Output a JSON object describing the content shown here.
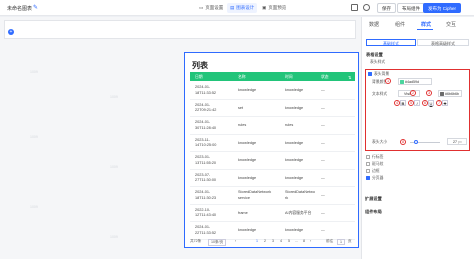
{
  "header": {
    "page_title": "未命名图表",
    "nav": [
      {
        "label": "页面设置",
        "active": false
      },
      {
        "label": "图表设计",
        "active": true
      },
      {
        "label": "页面预览",
        "active": false
      }
    ],
    "buttons": {
      "save": "保存",
      "publish": "布局组件",
      "export": "发布为 Cipher"
    }
  },
  "canvas": {
    "watermark": "1009"
  },
  "table_card": {
    "title": "列表",
    "columns": [
      "日期",
      "名称",
      "时间",
      "状态"
    ],
    "rows": [
      {
        "date": "2024-01-\n18T11:33:52",
        "name": "knowledge",
        "time": "knowledge",
        "status": "—"
      },
      {
        "date": "2024-01-\n22T09:21:42",
        "name": "set",
        "time": "knowledge",
        "status": "—"
      },
      {
        "date": "2024-01-\n30T11:28:40",
        "name": "rules",
        "time": "rules",
        "status": "—"
      },
      {
        "date": "2023-11-\n14T10:25:00",
        "name": "knowledge",
        "time": "knowledge",
        "status": "—"
      },
      {
        "date": "2023-01-\n13T11:55:20",
        "name": "knowledge",
        "time": "knowledge",
        "status": "—"
      },
      {
        "date": "2023-07-\n27T11:30:00",
        "name": "knowledge",
        "time": "knowledge",
        "status": "—"
      },
      {
        "date": "2024-01-\n18T11:30:23",
        "name": "StoredDataNetwork\nservice",
        "time": "StoredDataNetwo\nrk",
        "status": "—"
      },
      {
        "date": "2022-10-\n12T11:43:40",
        "name": "frame",
        "time": "AI内容服务平台",
        "status": "—"
      },
      {
        "date": "2024-01-\n22T11:33:52",
        "name": "knowledge",
        "time": "knowledge",
        "status": "—"
      }
    ],
    "pagination": {
      "total": "共72条",
      "page_size": "10条/页",
      "pages": [
        "1",
        "2",
        "3",
        "4",
        "5",
        "...",
        "8"
      ],
      "current_page": "1",
      "jump_label": "前往",
      "jump_value": "1",
      "page_suffix": "页"
    }
  },
  "panel": {
    "tabs": [
      {
        "label": "数据",
        "active": false
      },
      {
        "label": "组件",
        "active": false
      },
      {
        "label": "样式",
        "active": true
      },
      {
        "label": "交互",
        "active": false
      }
    ],
    "subtabs": [
      "基础样式",
      "表格高级样式"
    ],
    "section_table": "表格设置",
    "section_header_settings": "表头样式",
    "header_opts": {
      "bg_toggle": "表头背景",
      "bg_label": "背景颜色",
      "bg_value": "#4ad59d",
      "text_label": "文本样式",
      "font_value": "Vtsk",
      "text_color": "#6b6b6b",
      "style_label": "",
      "bold": "B",
      "italic": "I",
      "underline": "U",
      "strike": "S",
      "size_label": "表头大小",
      "size_value": "27",
      "size_unit": "px"
    },
    "options": [
      "行标签",
      "斑马纹",
      "边框",
      "分页器"
    ],
    "section_ext": "扩展设置",
    "section_layout": "组件布局",
    "badges": [
      "1",
      "2",
      "3",
      "4",
      "5",
      "6",
      "7",
      "8"
    ],
    "colors": {
      "accent": "#2f6bff",
      "header_green": "#22c47a",
      "highlight": "#e03030"
    }
  }
}
